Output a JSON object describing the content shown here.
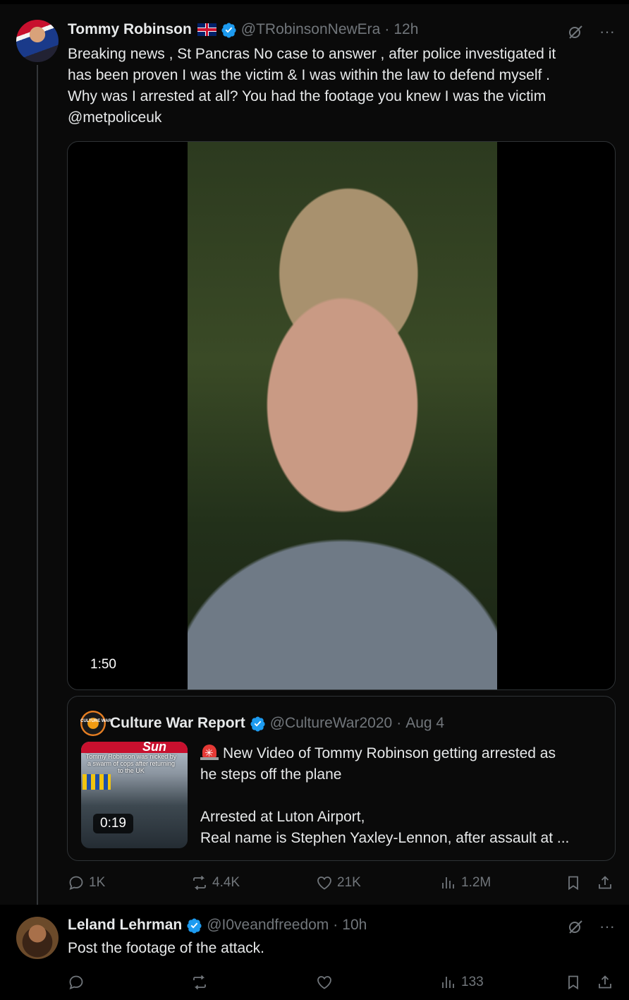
{
  "main_tweet": {
    "author_name": "Tommy Robinson",
    "author_handle": "@TRobinsonNewEra",
    "separator": "·",
    "time": "12h",
    "text": "Breaking news , St Pancras No case to answer , after police investigated it\nhas been proven I was the victim & I was within the law to defend myself .\nWhy was I arrested at all? You had the footage you knew I was the victim\n@metpoliceuk",
    "video_duration": "1:50",
    "quote": {
      "author_name": "Culture War Report",
      "author_handle": "@CultureWar2020",
      "separator": "·",
      "time": "Aug 4",
      "logo_text": "CULTURE WAR",
      "thumb_masthead": "Sun",
      "thumb_caption": "Tommy Robinson was nicked by a swarm of cops after returning to the UK",
      "thumb_duration": "0:19",
      "text": "New Video of Tommy Robinson getting arrested as\nhe steps off the plane\n\nArrested at Luton Airport,\nReal name is Stephen Yaxley-Lennon, after assault at ..."
    },
    "stats": {
      "replies": "1K",
      "reposts": "4.4K",
      "likes": "21K",
      "views": "1.2M"
    }
  },
  "reply_tweet": {
    "author_name": "Leland Lehrman",
    "author_handle": "@I0veandfreedom",
    "separator": "·",
    "time": "10h",
    "text": "Post the footage of the attack.",
    "stats": {
      "replies": "",
      "reposts": "",
      "likes": "",
      "views": "133"
    }
  },
  "colors": {
    "background": "#000000",
    "text": "#e7e9ea",
    "muted": "#71767b",
    "verified": "#1d9bf0",
    "border": "#2f3336"
  }
}
